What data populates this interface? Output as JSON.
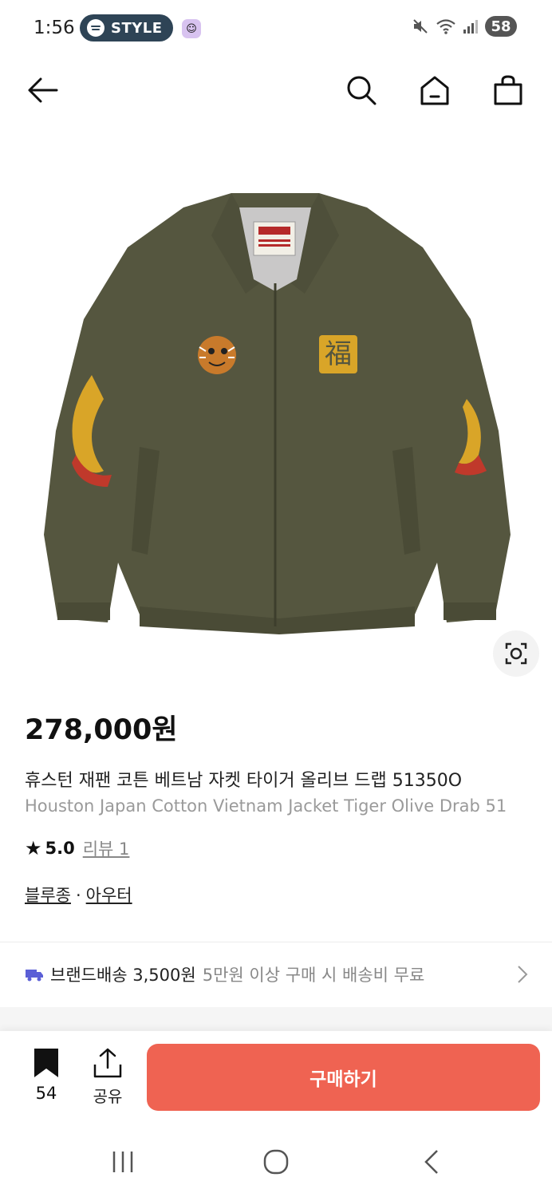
{
  "status_bar": {
    "time": "1:56",
    "pill_label": "STYLE",
    "battery": "58"
  },
  "nav": {
    "back_icon": "arrow-left-icon",
    "search_icon": "search-icon",
    "home_icon": "home-icon",
    "cart_icon": "shopping-bag-icon"
  },
  "product": {
    "price": "278,000원",
    "name_ko": "휴스턴 재팬 코튼 베트남 자켓 타이거 올리브 드랩 51350O",
    "name_en": "Houston Japan Cotton Vietnam Jacket Tiger Olive Drab 51",
    "rating": "5.0",
    "review": "리뷰 1",
    "category_1": "블루종",
    "category_sep": "·",
    "category_2": "아우터",
    "image_colors": {
      "jacket": "#55563f",
      "background": "#ffffff"
    }
  },
  "shipping": {
    "label": "브랜드배송 3,500원",
    "note": "5만원 이상 구매 시 배송비 무료",
    "icon_color": "#5b5fd6"
  },
  "action_bar": {
    "bookmark_count": "54",
    "share_label": "공유",
    "buy_label": "구매하기",
    "accent": "#ef6352"
  }
}
